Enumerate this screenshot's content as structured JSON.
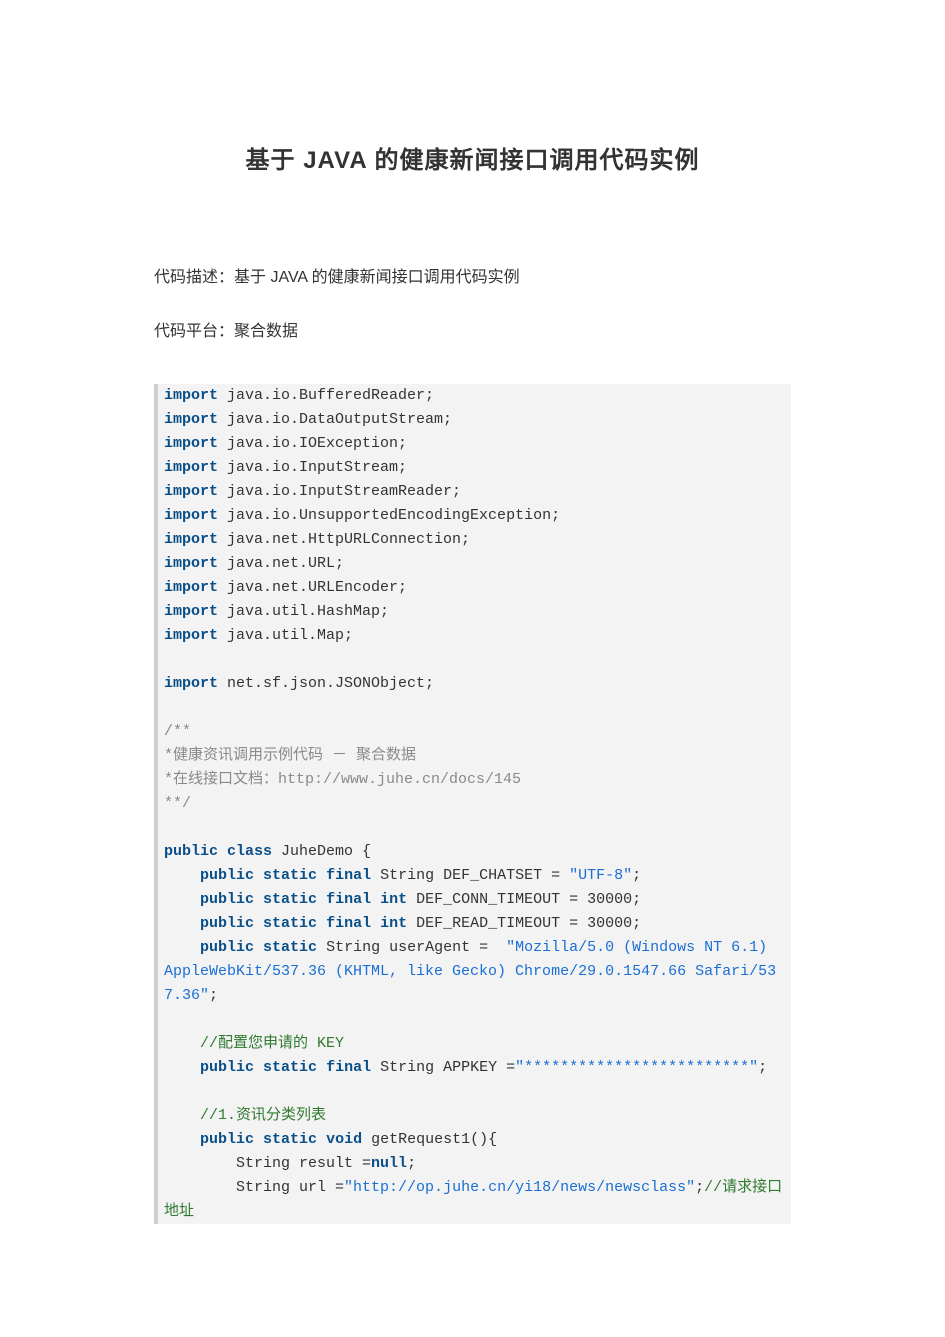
{
  "title": "基于 JAVA 的健康新闻接口调用代码实例",
  "meta": {
    "desc_label": "代码描述：",
    "desc_value": "基于 JAVA 的健康新闻接口调用代码实例",
    "platform_label": "代码平台：",
    "platform_value": "聚合数据"
  },
  "code": {
    "kw_import": "import",
    "kw_public": "public",
    "kw_class": "class",
    "kw_static": "static",
    "kw_final": "final",
    "kw_int": "int",
    "kw_void": "void",
    "kw_null": "null",
    "imp1": " java.io.BufferedReader;",
    "imp2": " java.io.DataOutputStream;",
    "imp3": " java.io.IOException;",
    "imp4": " java.io.InputStream;",
    "imp5": " java.io.InputStreamReader;",
    "imp6": " java.io.UnsupportedEncodingException;",
    "imp7": " java.net.HttpURLConnection;",
    "imp8": " java.net.URL;",
    "imp9": " java.net.URLEncoder;",
    "imp10": " java.util.HashMap;",
    "imp11": " java.util.Map;",
    "imp12": " net.sf.json.JSONObject;",
    "doc_open": "/**",
    "doc_l1": "*健康资讯调用示例代码 － 聚合数据",
    "doc_l2a": "*在线接口文档：",
    "doc_l2b": "http://www.juhe.cn/docs/145",
    "doc_close": "**/",
    "class_decl_a": " JuheDemo {",
    "l_def_chatset_a": " String DEF_CHATSET = ",
    "l_def_chatset_b": "\"UTF-8\"",
    "l_def_chatset_c": ";",
    "l_conn_a": " DEF_CONN_TIMEOUT = 30000;",
    "l_read_a": " DEF_READ_TIMEOUT = 30000;",
    "l_useragent_a": " String userAgent =  ",
    "l_useragent_b": "\"Mozilla/5.0 (Windows NT 6.1) AppleWebKit/537.36 (KHTML, like Gecko) Chrome/29.0.1547.66 Safari/537.36\"",
    "l_useragent_c": ";",
    "cmt_key": "    //配置您申请的 KEY",
    "l_appkey_a": " String APPKEY =",
    "l_appkey_b": "\"*************************\"",
    "l_appkey_c": ";",
    "cmt_list": "    //1.资讯分类列表",
    "l_getreq_a": " getRequest1(){",
    "l_result_a": "        String result =",
    "l_result_c": ";",
    "l_url_a": "        String url =",
    "l_url_b": "\"http://op.juhe.cn/yi18/news/newsclass\"",
    "l_url_c": ";",
    "l_url_cmt": "//请求接口地址",
    "indent1": "    ",
    "space": " "
  }
}
